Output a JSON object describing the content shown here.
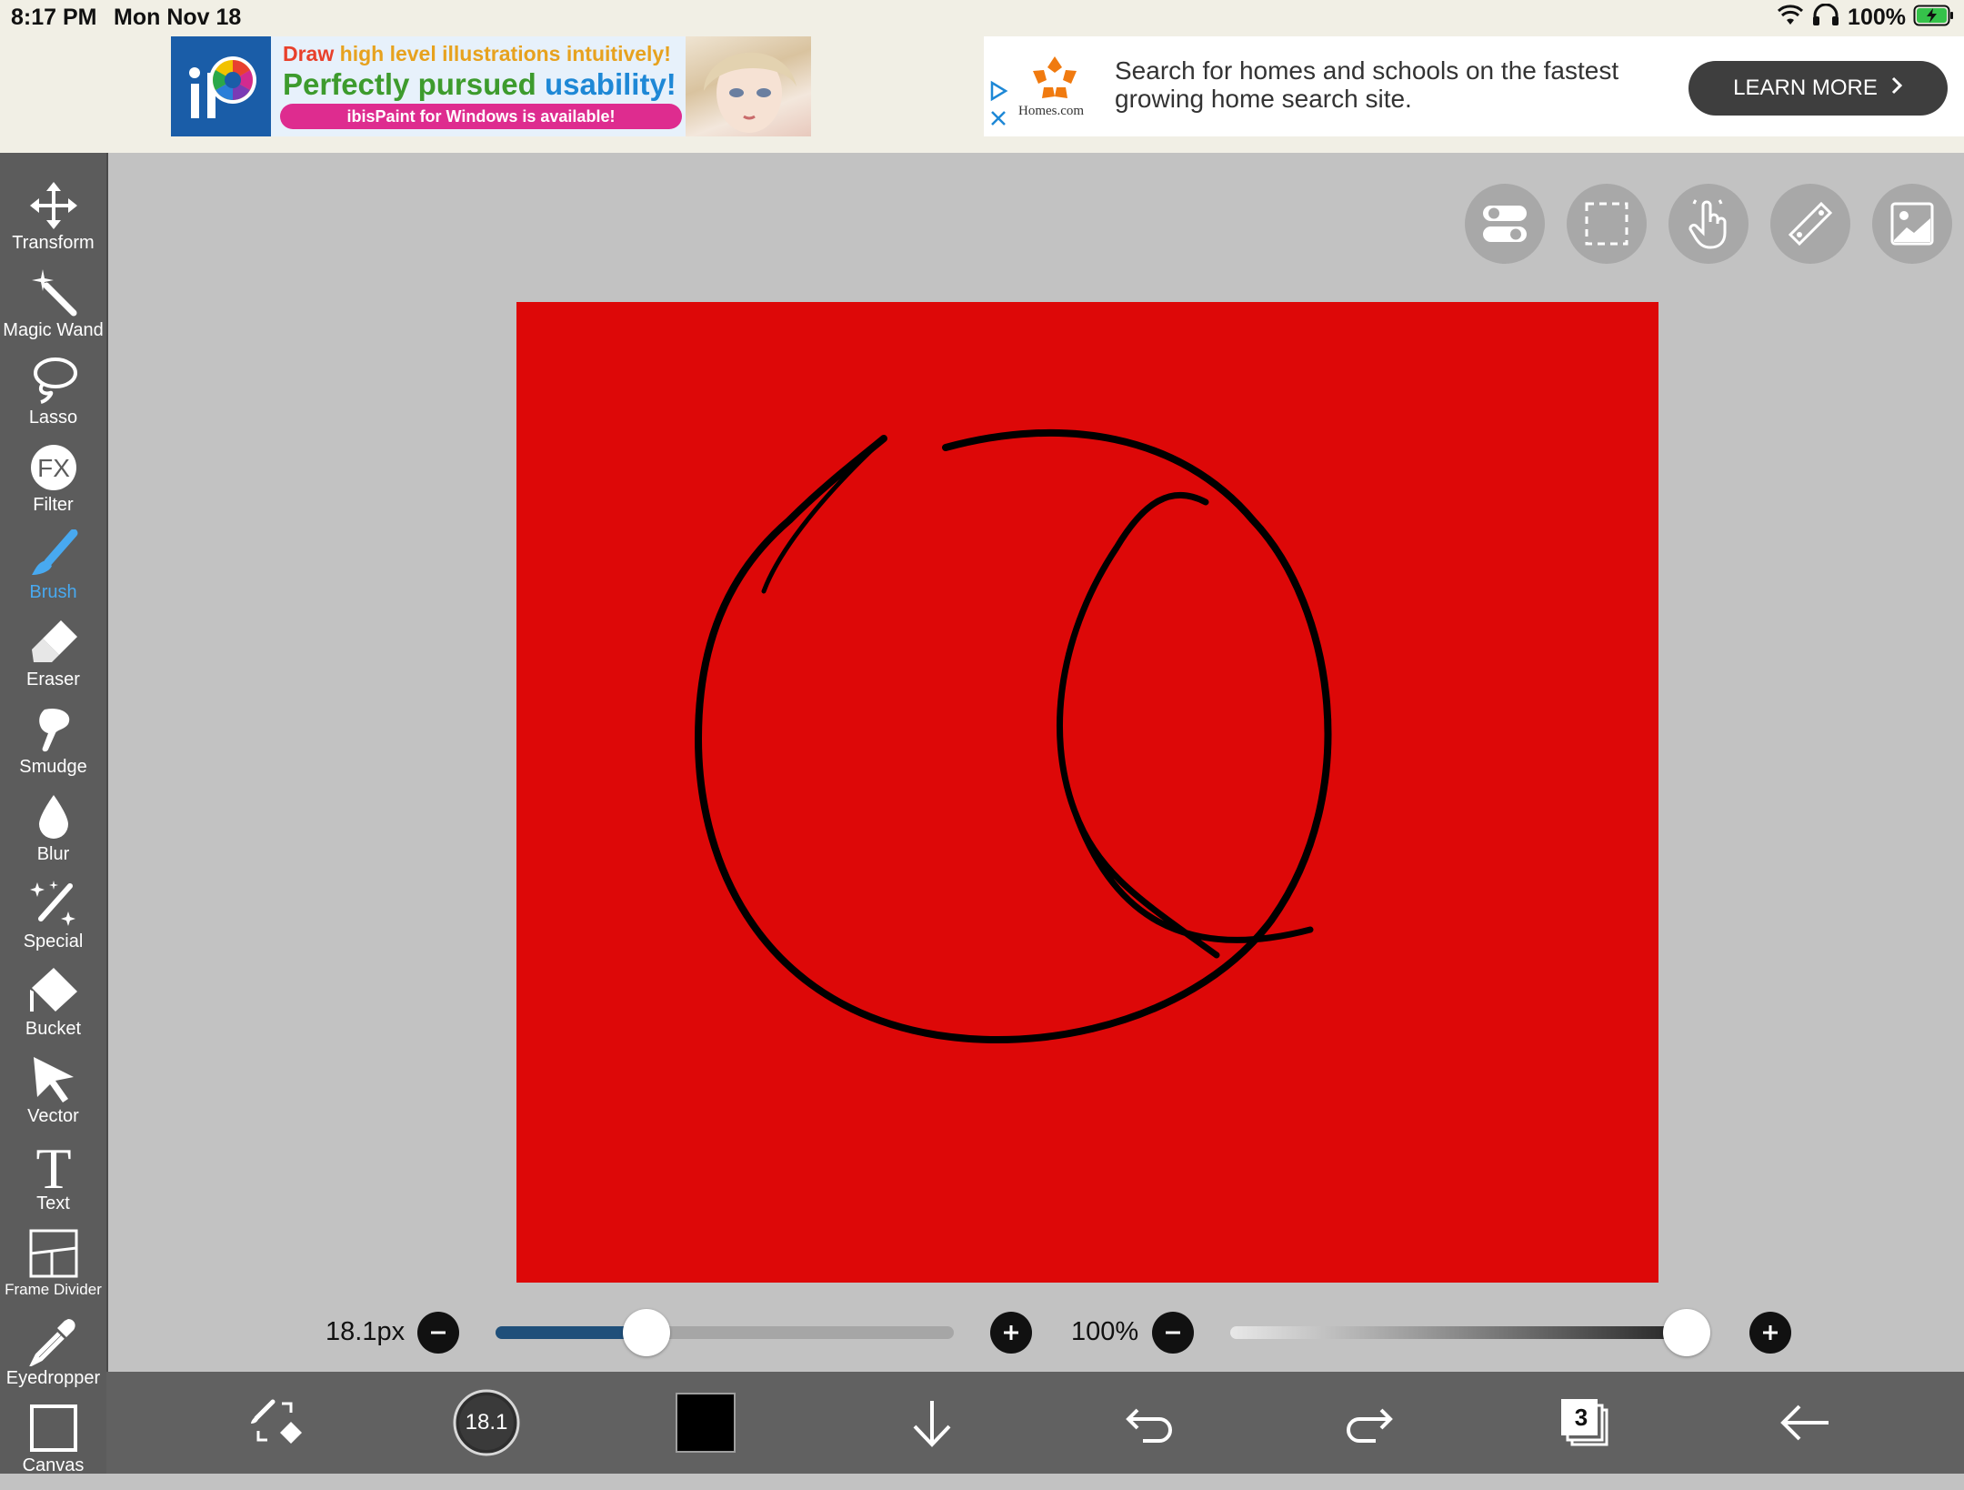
{
  "status_bar": {
    "time": "8:17 PM",
    "date": "Mon Nov 18",
    "battery": "100%"
  },
  "ads": {
    "ibis": {
      "line1_a": "Draw",
      "line1_b": "high level",
      "line1_c": "illustrations intuitively!",
      "line2_a": "Perfectly pursued",
      "line2_b": "usability!",
      "pill": "ibisPaint for Windows is available!"
    },
    "homes": {
      "brand": "Homes.com",
      "text": "Search for homes and schools on the fastest growing home search site.",
      "cta": "LEARN MORE"
    }
  },
  "tools": [
    {
      "id": "transform",
      "label": "Transform",
      "icon": "move-arrows-icon"
    },
    {
      "id": "magic-wand",
      "label": "Magic Wand",
      "icon": "magic-wand-icon"
    },
    {
      "id": "lasso",
      "label": "Lasso",
      "icon": "lasso-icon"
    },
    {
      "id": "filter",
      "label": "Filter",
      "icon": "fx-icon"
    },
    {
      "id": "brush",
      "label": "Brush",
      "icon": "brush-icon",
      "active": true
    },
    {
      "id": "eraser",
      "label": "Eraser",
      "icon": "eraser-icon"
    },
    {
      "id": "smudge",
      "label": "Smudge",
      "icon": "smudge-icon"
    },
    {
      "id": "blur",
      "label": "Blur",
      "icon": "drop-icon"
    },
    {
      "id": "special",
      "label": "Special",
      "icon": "sparkle-pen-icon"
    },
    {
      "id": "bucket",
      "label": "Bucket",
      "icon": "bucket-icon"
    },
    {
      "id": "vector",
      "label": "Vector",
      "icon": "cursor-arrow-icon"
    },
    {
      "id": "text",
      "label": "Text",
      "icon": "text-t-icon"
    },
    {
      "id": "frame-divider",
      "label": "Frame Divider",
      "icon": "frame-divider-icon"
    },
    {
      "id": "eyedropper",
      "label": "Eyedropper",
      "icon": "eyedropper-icon"
    },
    {
      "id": "canvas",
      "label": "Canvas",
      "icon": "canvas-icon"
    }
  ],
  "brush": {
    "size_label": "18.1px",
    "size_fraction": 0.33,
    "opacity_label": "100%",
    "opacity_fraction": 1.0,
    "thumb_label": "18.1"
  },
  "layers": {
    "count": "3"
  },
  "colors": {
    "canvas": "#dd0808",
    "stroke": "#000000",
    "accent": "#48a9f0",
    "brush_track": "#1f4f7a"
  }
}
